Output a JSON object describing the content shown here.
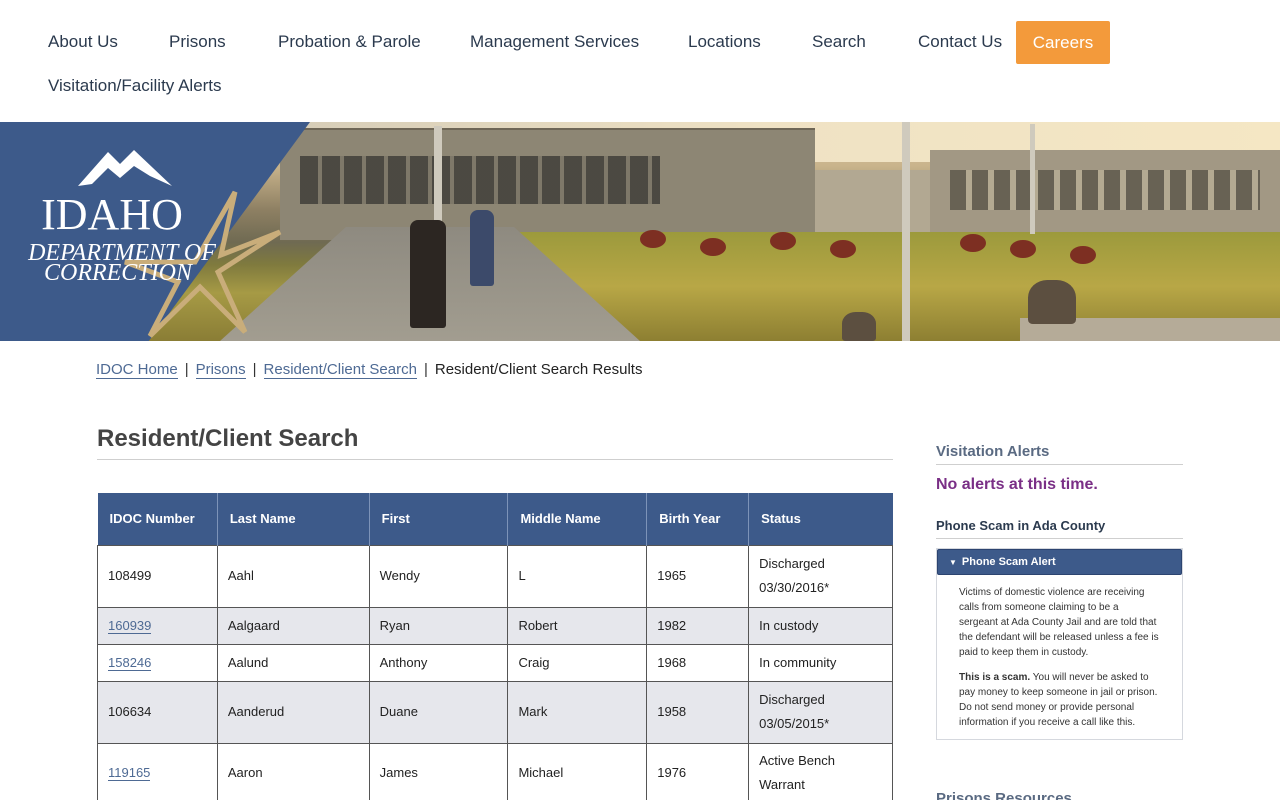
{
  "nav": {
    "items": [
      "About Us",
      "Prisons",
      "Probation & Parole",
      "Management Services",
      "Locations",
      "Search",
      "Contact Us"
    ],
    "careers": "Careers",
    "second_row": "Visitation/Facility Alerts"
  },
  "logo": {
    "line1": "IDAHO",
    "line2": "DEPARTMENT OF",
    "line3": "CORRECTION"
  },
  "breadcrumb": {
    "home": "IDOC Home",
    "prisons": "Prisons",
    "search": "Resident/Client Search",
    "current": "Resident/Client Search Results",
    "sep": "|"
  },
  "main": {
    "title": "Resident/Client Search"
  },
  "table": {
    "headers": [
      "IDOC Number",
      "Last Name",
      "First",
      "Middle Name",
      "Birth Year",
      "Status"
    ],
    "rows": [
      {
        "idoc": "108499",
        "last": "Aahl",
        "first": "Wendy",
        "middle": "L",
        "birth": "1965",
        "status_1": "Discharged",
        "status_2": "03/30/2016*"
      },
      {
        "idoc": "160939",
        "last": "Aalgaard",
        "first": "Ryan",
        "middle": "Robert",
        "birth": "1982",
        "status_1": "In custody",
        "status_2": ""
      },
      {
        "idoc": "158246",
        "last": "Aalund",
        "first": "Anthony",
        "middle": "Craig",
        "birth": "1968",
        "status_1": "In community",
        "status_2": ""
      },
      {
        "idoc": "106634",
        "last": "Aanderud",
        "first": "Duane",
        "middle": "Mark",
        "birth": "1958",
        "status_1": "Discharged",
        "status_2": "03/05/2015*"
      },
      {
        "idoc": "119165",
        "last": "Aaron",
        "first": "James",
        "middle": "Michael",
        "birth": "1976",
        "status_1": "Active Bench",
        "status_2": "Warrant"
      }
    ]
  },
  "sidebar": {
    "visitation_title": "Visitation Alerts",
    "no_alerts": "No alerts at this time.",
    "scam_title": "Phone Scam in Ada County",
    "alert_head": "Phone Scam Alert",
    "alert_p1": "Victims of domestic violence are receiving calls from someone claiming to be a sergeant at Ada County Jail and are told that the defendant will be released unless a fee is paid to keep them in custody.",
    "alert_p2_bold": "This is a scam.",
    "alert_p2_rest": " You will never be asked to pay money to keep someone in jail or prison. Do not send money or provide personal information if you receive a call like this.",
    "more_title": "Prisons Resources"
  },
  "colors": {
    "brand_blue": "#3d5a8a",
    "careers_orange": "#f39a3b",
    "alert_purple": "#7a2f86",
    "link_blue": "#4e6a94"
  }
}
